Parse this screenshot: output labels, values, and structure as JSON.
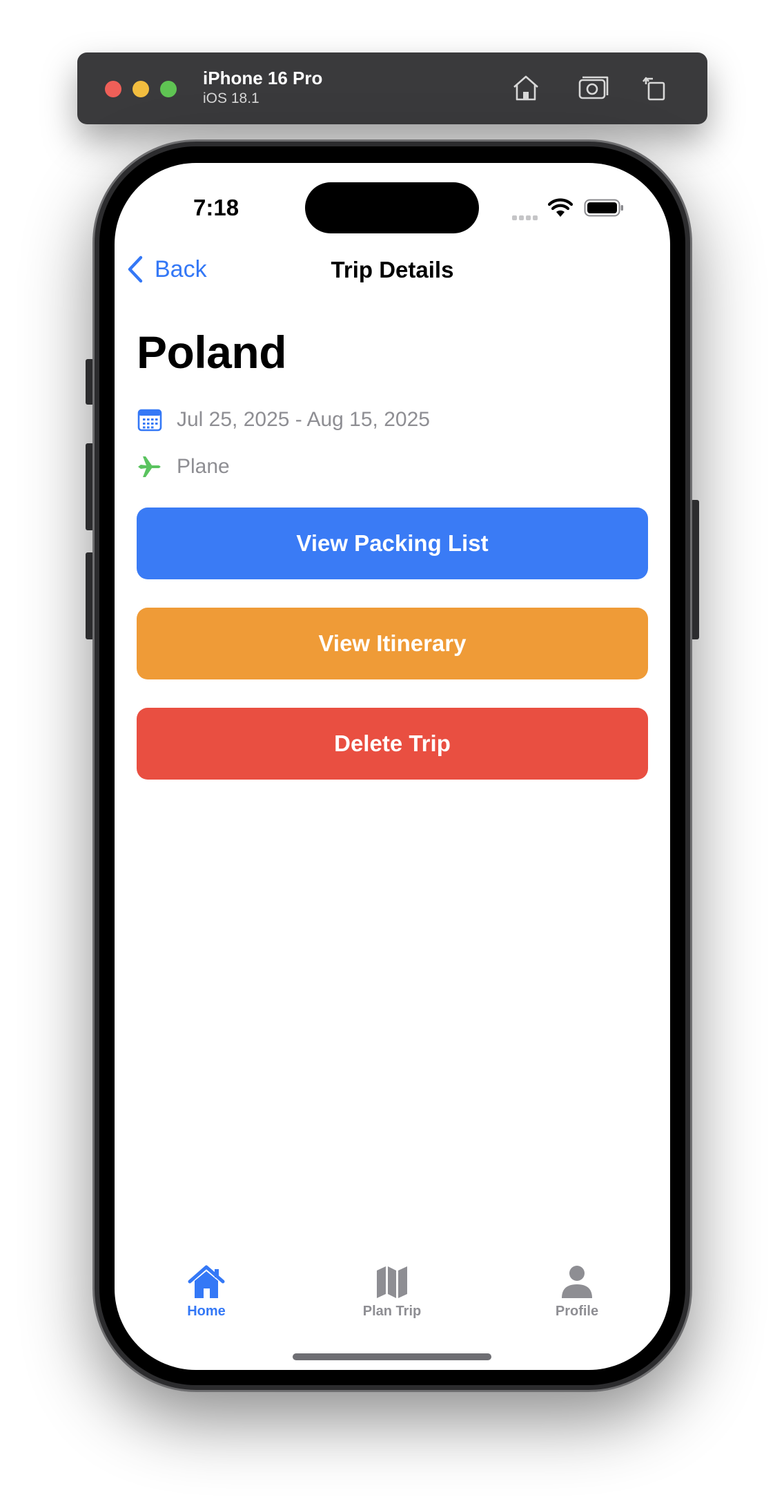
{
  "simulator": {
    "device_name": "iPhone 16 Pro",
    "os_version": "iOS 18.1",
    "toolbar_icons": [
      "home-icon",
      "screenshot-icon",
      "rotate-icon"
    ]
  },
  "status_bar": {
    "time": "7:18"
  },
  "nav": {
    "back_label": "Back",
    "title": "Trip Details"
  },
  "trip": {
    "destination": "Poland",
    "dates": "Jul 25, 2025 - Aug 15, 2025",
    "transport": "Plane"
  },
  "actions": {
    "packing_label": "View Packing List",
    "itinerary_label": "View Itinerary",
    "delete_label": "Delete Trip"
  },
  "tab_bar": {
    "items": [
      {
        "label": "Home",
        "icon": "house-icon",
        "active": true
      },
      {
        "label": "Plan Trip",
        "icon": "map-icon",
        "active": false
      },
      {
        "label": "Profile",
        "icon": "person-icon",
        "active": false
      }
    ]
  },
  "colors": {
    "accent": "#3478f6",
    "packing_button": "#3a7bf5",
    "itinerary_button": "#ef9b37",
    "delete_button": "#e94f41",
    "transport_icon": "#5ac35f",
    "secondary_text": "#8e8e93",
    "inactive_tab": "#8e8e93"
  }
}
